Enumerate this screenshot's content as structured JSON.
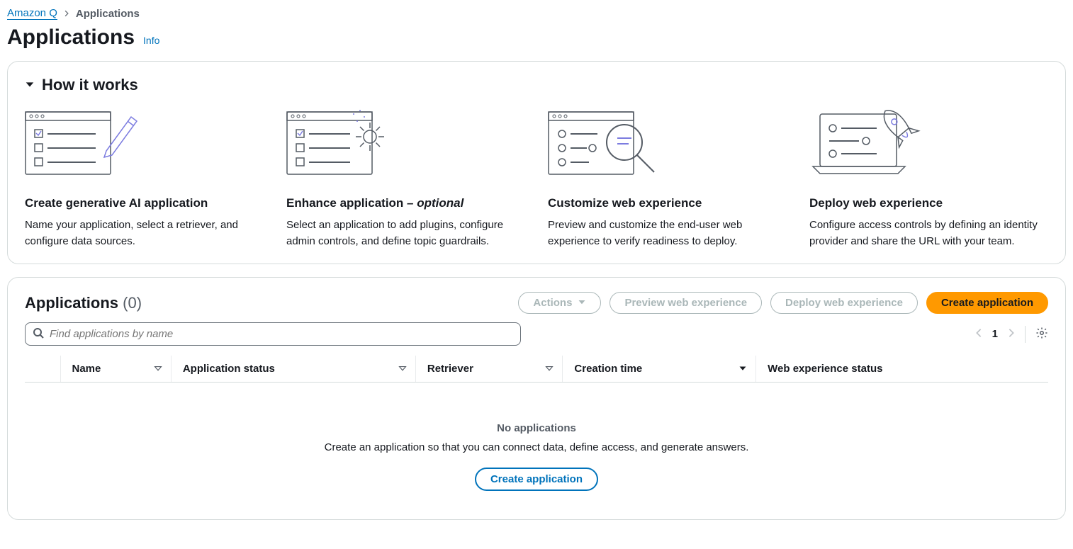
{
  "breadcrumb": {
    "root": "Amazon Q",
    "current": "Applications"
  },
  "header": {
    "title": "Applications",
    "info": "Info"
  },
  "how_it_works": {
    "title": "How it works",
    "steps": [
      {
        "title": "Create generative AI application",
        "optional": "",
        "desc": "Name your application, select a retriever, and configure data sources."
      },
      {
        "title": "Enhance application",
        "optional": " – optional",
        "desc": "Select an application to add plugins, configure admin controls, and define topic guardrails."
      },
      {
        "title": "Customize web experience",
        "optional": "",
        "desc": "Preview and customize the end-user web experience to verify readiness to deploy."
      },
      {
        "title": "Deploy web experience",
        "optional": "",
        "desc": "Configure access controls by defining an identity provider and share the URL with your team."
      }
    ]
  },
  "apps": {
    "title": "Applications",
    "count_label": "(0)",
    "actions": {
      "actions": "Actions",
      "preview": "Preview web experience",
      "deploy": "Deploy web experience",
      "create": "Create application"
    },
    "search_placeholder": "Find applications by name",
    "page": "1",
    "columns": {
      "name": "Name",
      "status": "Application status",
      "retriever": "Retriever",
      "creation": "Creation time",
      "webexp": "Web experience status"
    },
    "empty": {
      "title": "No applications",
      "desc": "Create an application so that you can connect data, define access, and generate answers.",
      "cta": "Create application"
    }
  }
}
